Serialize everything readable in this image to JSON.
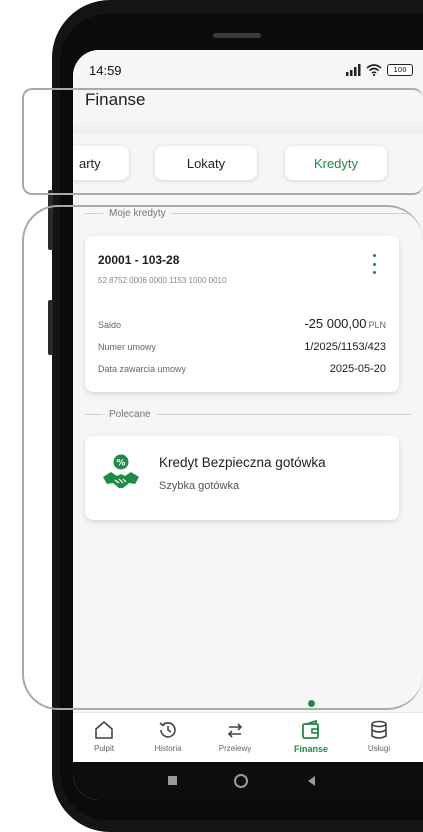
{
  "status_bar": {
    "time": "14:59",
    "battery": "100"
  },
  "page_title": "Finanse",
  "tabs": [
    {
      "label": "arty",
      "active": false
    },
    {
      "label": "Lokaty",
      "active": false
    },
    {
      "label": "Kredyty",
      "active": true
    }
  ],
  "loans_section": {
    "label": "Moje kredyty",
    "loan": {
      "id": "20001 - 103-28",
      "account_number": "52 8752 0006 0000 1153 1000 0010",
      "saldo_label": "Saldo",
      "saldo_value": "-25 000,00",
      "saldo_currency": "PLN",
      "contract_label": "Numer umowy",
      "contract_value": "1/2025/1153/423",
      "date_label": "Data zawarcia umowy",
      "date_value": "2025-05-20"
    }
  },
  "recommended_section": {
    "label": "Polecane",
    "promo": {
      "title": "Kredyt Bezpieczna gotówka",
      "subtitle": "Szybka gotówka",
      "icon": "handshake-percent-icon"
    }
  },
  "bottom_nav": [
    {
      "label": "Pulpit",
      "icon": "home-icon",
      "active": false
    },
    {
      "label": "Historia",
      "icon": "history-icon",
      "active": false
    },
    {
      "label": "Przelewy",
      "icon": "transfer-icon",
      "active": false
    },
    {
      "label": "Finanse",
      "icon": "wallet-icon",
      "active": true
    },
    {
      "label": "Usługi",
      "icon": "services-icon",
      "active": false
    }
  ],
  "colors": {
    "accent": "#1f8a45",
    "screen_bg": "#f6f6f6",
    "callout": "#a9a9a9"
  }
}
